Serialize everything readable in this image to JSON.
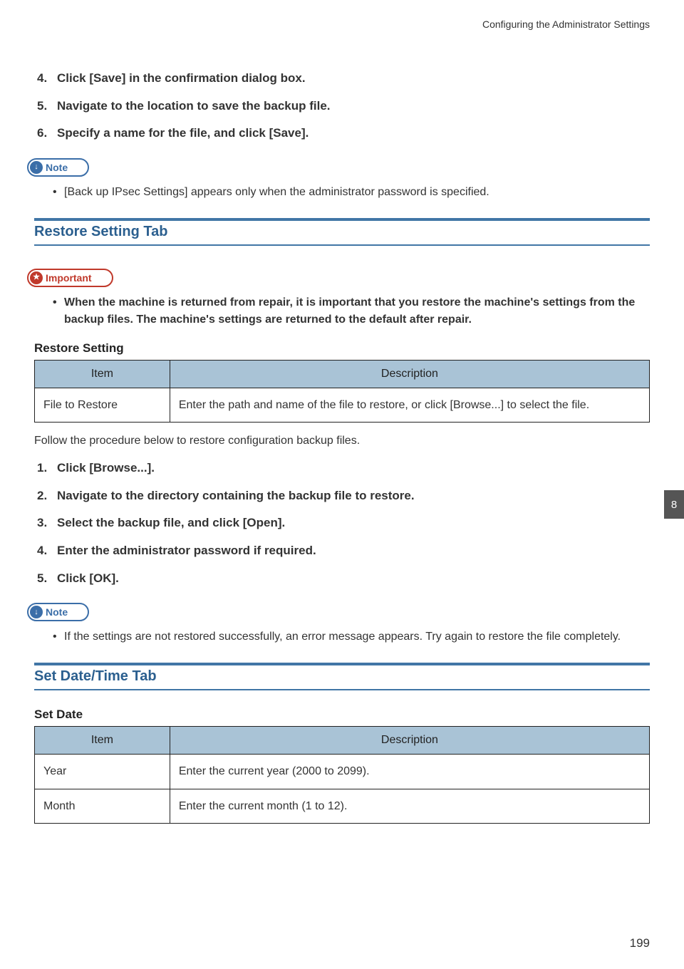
{
  "running_head": "Configuring the Administrator Settings",
  "top_steps": [
    {
      "num": "4.",
      "text": "Click [Save] in the confirmation dialog box."
    },
    {
      "num": "5.",
      "text": "Navigate to the location to save the backup file."
    },
    {
      "num": "6.",
      "text": "Specify a name for the file, and click [Save]."
    }
  ],
  "callouts": {
    "note_label": "Note",
    "note_glyph": "↓",
    "important_label": "Important",
    "important_glyph": "★"
  },
  "top_note_bullets": [
    "[Back up IPsec Settings] appears only when the administrator password is specified."
  ],
  "restore_section": {
    "title": "Restore Setting Tab",
    "important_bullets": [
      "When the machine is returned from repair, it is important that you restore the machine's settings from the backup files. The machine's settings are returned to the default after repair."
    ],
    "table_caption": "Restore Setting",
    "table_headers": {
      "item": "Item",
      "desc": "Description"
    },
    "table_rows": [
      {
        "item": "File to Restore",
        "desc": "Enter the path and name of the file to restore, or click [Browse...] to select the file."
      }
    ],
    "lead_in": "Follow the procedure below to restore configuration backup files.",
    "steps": [
      {
        "num": "1.",
        "text": "Click [Browse...]."
      },
      {
        "num": "2.",
        "text": "Navigate to the directory containing the backup file to restore."
      },
      {
        "num": "3.",
        "text": "Select the backup file, and click [Open]."
      },
      {
        "num": "4.",
        "text": "Enter the administrator password if required."
      },
      {
        "num": "5.",
        "text": "Click [OK]."
      }
    ],
    "note_bullets": [
      "If the settings are not restored successfully, an error message appears. Try again to restore the file completely."
    ]
  },
  "datetime_section": {
    "title": "Set Date/Time Tab",
    "sub_caption": "Set Date",
    "table_headers": {
      "item": "Item",
      "desc": "Description"
    },
    "table_rows": [
      {
        "item": "Year",
        "desc": "Enter the current year (2000 to 2099)."
      },
      {
        "item": "Month",
        "desc": "Enter the current month (1 to 12)."
      }
    ]
  },
  "side_tab": "8",
  "page_number": "199"
}
